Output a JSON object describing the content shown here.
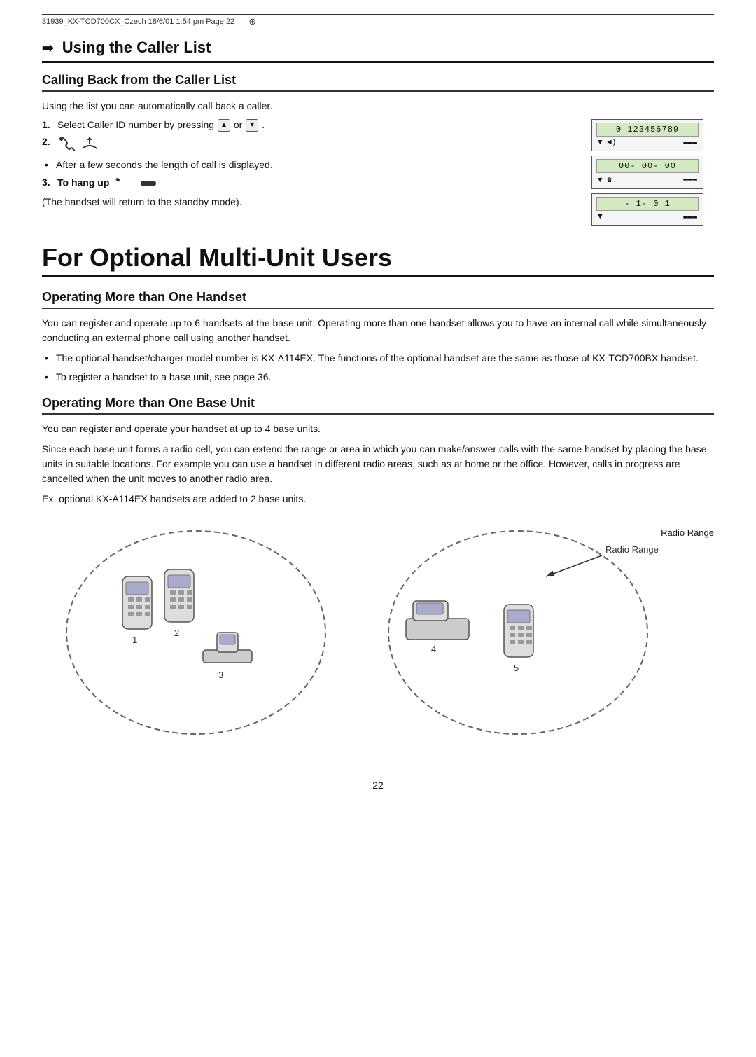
{
  "header": {
    "text": "31939_KX-TCD700CX_Czech   18/6/01   1:54 pm   Page  22"
  },
  "callerList": {
    "title": "Using the Caller List",
    "subsection1": {
      "heading": "Calling Back from the Caller List",
      "intro": "Using the list you can automatically call back a caller.",
      "step1": {
        "textBefore": "Select Caller ID number by pressing ",
        "or": "or"
      },
      "step2": {
        "note": "After a few seconds the length of call is displayed."
      },
      "step3": {
        "bold": "To hang up",
        "note": "(The handset will return to the standby mode)."
      }
    }
  },
  "displayPanel": {
    "screen1": {
      "text": "0 123456789",
      "leftIndicator": "▼ ◄)",
      "rightIndicator": "▬▬▬"
    },
    "screen2": {
      "text": "00- 00- 00",
      "leftIndicator": "▼ ☎",
      "rightIndicator": "▬▬▬"
    },
    "screen3": {
      "text": "- 1-        0 1",
      "leftIndicator": "▼",
      "rightIndicator": "▬▬▬"
    }
  },
  "multiUnit": {
    "title": "For Optional Multi-Unit Users",
    "section1": {
      "heading": "Operating More than One Handset",
      "intro": "You can register and operate up to 6 handsets at the base unit. Operating more than one handset allows you to have an internal call while simultaneously conducting an external phone call using another handset.",
      "bullet1": "The optional handset/charger model number is KX-A114EX. The functions of the optional handset are the same as those of KX-TCD700BX handset.",
      "bullet2": "To register a handset to a base unit, see page 36."
    },
    "section2": {
      "heading": "Operating More than One Base Unit",
      "intro": "You can register and operate your handset at up to 4 base units.",
      "para2": "Since each base unit forms a radio cell, you can extend the range or area in which you can make/answer calls with the same handset by placing the base units in suitable locations. For example you can use a handset in different radio areas, such as at home or the office. However, calls in progress are cancelled when the unit moves to another radio area.",
      "example": "Ex. optional KX-A114EX handsets are added to 2 base units."
    }
  },
  "diagram": {
    "radioRangeLabel": "Radio Range",
    "numbers": [
      "1",
      "2",
      "3",
      "4",
      "5"
    ]
  },
  "page": {
    "number": "22"
  }
}
